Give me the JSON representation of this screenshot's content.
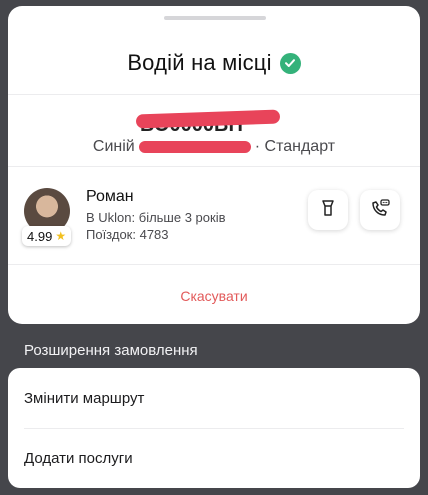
{
  "status": {
    "title": "Водій на місці",
    "icon": "check-circle-icon"
  },
  "car": {
    "plate": "ВО0000ВН",
    "color": "Синій",
    "separator": "·",
    "tariff": "Стандарт"
  },
  "driver": {
    "name": "Роман",
    "tenure": "В Uklon: більше 3 років",
    "trips": "Поїздок: 4783",
    "rating": "4.99"
  },
  "actions": {
    "cancel": "Скасувати"
  },
  "extensions": {
    "title": "Розширення замовлення",
    "items": [
      {
        "label": "Змінити маршрут"
      },
      {
        "label": "Додати послуги"
      }
    ]
  },
  "colors": {
    "accent_green": "#34b27a",
    "cancel_red": "#e25a5a",
    "background": "#45464b"
  }
}
